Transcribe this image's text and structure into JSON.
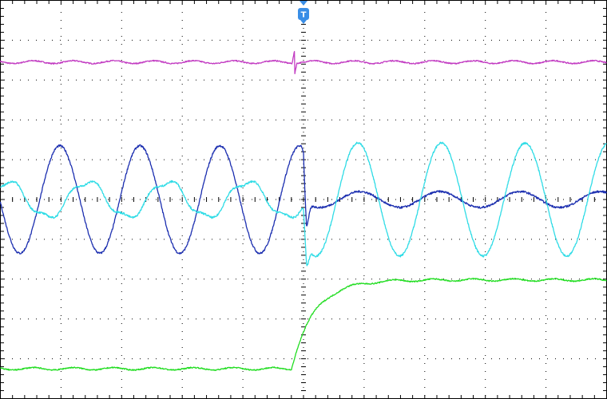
{
  "chart_data": {
    "type": "line",
    "title": "",
    "xlabel": "",
    "ylabel": "",
    "grid": true,
    "grid_style": "dotted",
    "background_color": "#ffffff",
    "divisions": {
      "x": 10,
      "y": 10
    },
    "xlim": [
      -5,
      5
    ],
    "ylim": [
      -5,
      5
    ],
    "trigger": {
      "label": "T",
      "x": 0,
      "color": "#3a8ee6"
    },
    "series": [
      {
        "id": "ch-magenta",
        "color": "#c23cc2",
        "kind": "dc-with-glitch",
        "level": 3.45,
        "glitch_x": -0.15,
        "glitch_amplitude": 0.3
      },
      {
        "id": "ch-navy",
        "color": "#1c2fb0",
        "kind": "sine",
        "offset": 0.0,
        "before": {
          "amplitude": 1.35,
          "period": 1.32,
          "phase_x": -4.35
        },
        "after": {
          "amplitude": 0.2,
          "period": 1.32,
          "phase_x": 0.6
        }
      },
      {
        "id": "ch-cyan",
        "color": "#30dce6",
        "kind": "sine",
        "offset": 0.0,
        "before": {
          "amplitude": 0.45,
          "period": 1.32,
          "phase_x": -3.9
        },
        "after": {
          "amplitude": 1.42,
          "period": 1.38,
          "phase_x": 0.55
        }
      },
      {
        "id": "ch-green",
        "color": "#22dd22",
        "kind": "step",
        "low": -4.25,
        "high": -2.02,
        "step_x": -0.2,
        "rise_time": 1.2
      }
    ]
  }
}
